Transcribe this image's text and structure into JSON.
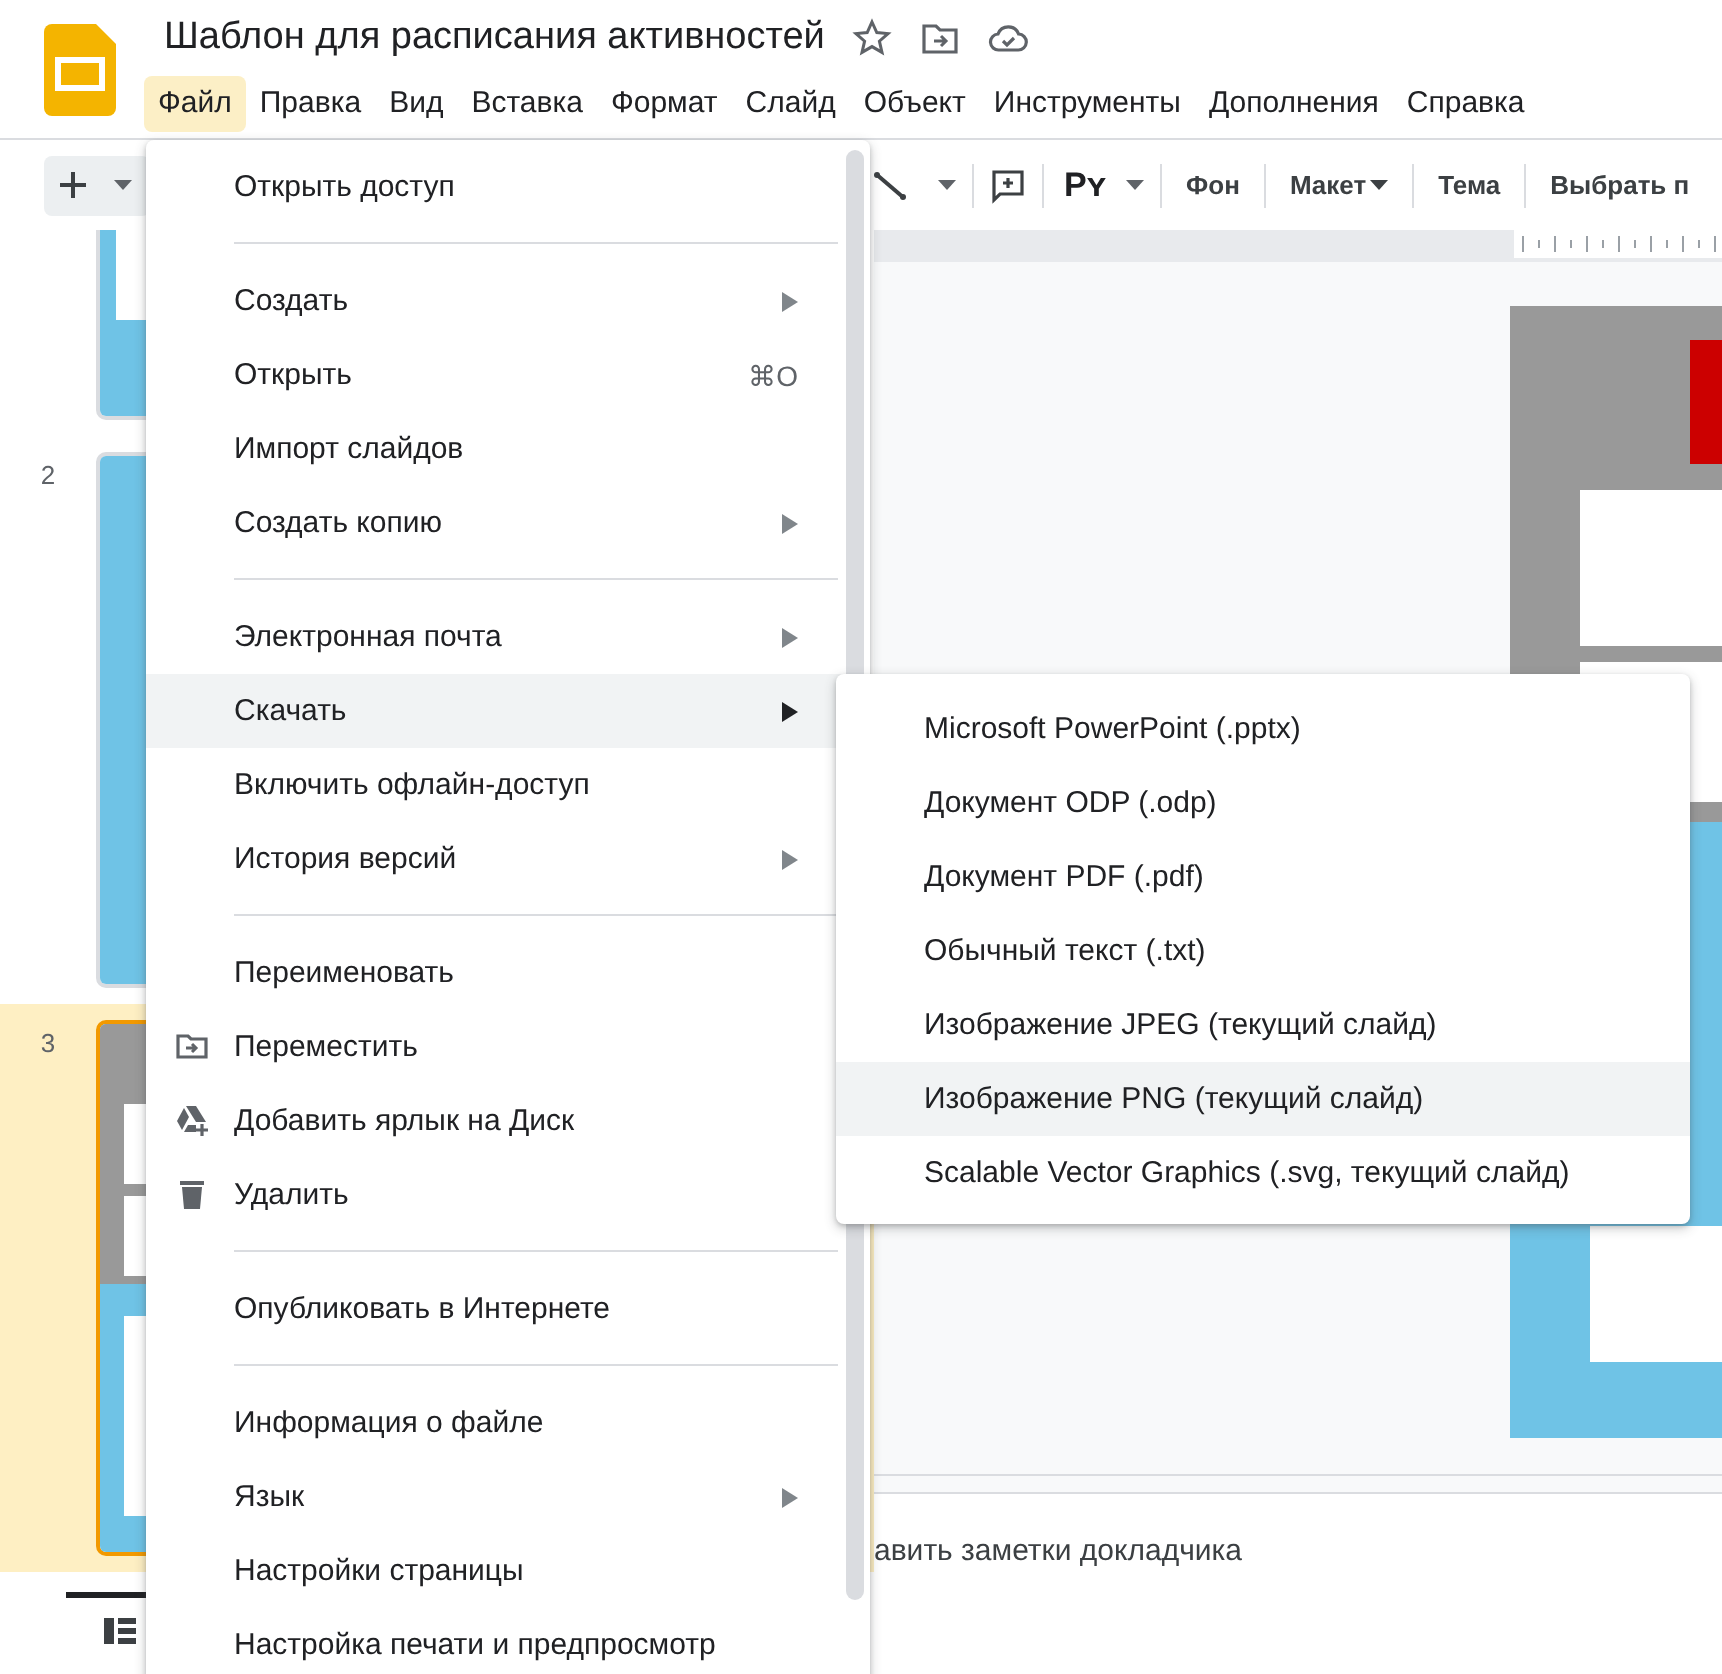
{
  "app": {
    "title": "Шаблон для расписания активностей"
  },
  "menubar": [
    {
      "label": "Файл",
      "selected": true
    },
    {
      "label": "Правка",
      "selected": false
    },
    {
      "label": "Вид",
      "selected": false
    },
    {
      "label": "Вставка",
      "selected": false
    },
    {
      "label": "Формат",
      "selected": false
    },
    {
      "label": "Слайд",
      "selected": false
    },
    {
      "label": "Объект",
      "selected": false
    },
    {
      "label": "Инструменты",
      "selected": false
    },
    {
      "label": "Дополнения",
      "selected": false
    },
    {
      "label": "Справка",
      "selected": false
    }
  ],
  "toolbar": {
    "format_label": "Pʏ",
    "items": [
      {
        "kind": "text",
        "label": "Фон"
      },
      {
        "kind": "dropdown",
        "label": "Макет"
      },
      {
        "kind": "text",
        "label": "Тема"
      },
      {
        "kind": "text",
        "label": "Выбрать п"
      }
    ]
  },
  "filmstrip": {
    "slides": [
      {
        "selected": false
      },
      {
        "number": "2",
        "selected": false
      },
      {
        "number": "3",
        "selected": true
      }
    ]
  },
  "notes": {
    "text": "авить заметки докладчика"
  },
  "file_menu": [
    {
      "kind": "item",
      "label": "Открыть доступ",
      "has_submenu": false,
      "selected": false
    },
    {
      "kind": "separator"
    },
    {
      "kind": "item",
      "label": "Создать",
      "has_submenu": true,
      "selected": false
    },
    {
      "kind": "item",
      "label": "Открыть",
      "shortcut": "⌘O",
      "has_submenu": false,
      "selected": false
    },
    {
      "kind": "item",
      "label": "Импорт слайдов",
      "has_submenu": false,
      "selected": false
    },
    {
      "kind": "item",
      "label": "Создать копию",
      "has_submenu": true,
      "selected": false
    },
    {
      "kind": "separator"
    },
    {
      "kind": "item",
      "label": "Электронная почта",
      "has_submenu": true,
      "selected": false
    },
    {
      "kind": "item",
      "label": "Скачать",
      "has_submenu": true,
      "selected": true
    },
    {
      "kind": "item",
      "label": "Включить офлайн-доступ",
      "has_submenu": false,
      "selected": false
    },
    {
      "kind": "item",
      "label": "История версий",
      "has_submenu": true,
      "selected": false
    },
    {
      "kind": "separator"
    },
    {
      "kind": "item",
      "label": "Переименовать",
      "has_submenu": false,
      "selected": false
    },
    {
      "kind": "move",
      "label": "Переместить",
      "has_submenu": false,
      "selected": false
    },
    {
      "kind": "shortcut",
      "label": "Добавить ярлык на Диск",
      "has_submenu": false,
      "selected": false
    },
    {
      "kind": "delete",
      "label": "Удалить",
      "has_submenu": false,
      "selected": false
    },
    {
      "kind": "separator"
    },
    {
      "kind": "item",
      "label": "Опубликовать в Интернете",
      "has_submenu": false,
      "selected": false
    },
    {
      "kind": "separator"
    },
    {
      "kind": "item",
      "label": "Информация о файле",
      "has_submenu": false,
      "selected": false
    },
    {
      "kind": "item",
      "label": "Язык",
      "has_submenu": true,
      "selected": false
    },
    {
      "kind": "item",
      "label": "Настройки страницы",
      "has_submenu": false,
      "selected": false
    },
    {
      "kind": "item",
      "label": "Настройка печати и предпросмотр",
      "has_submenu": false,
      "selected": false
    }
  ],
  "download_menu": [
    {
      "label": "Microsoft PowerPoint (.pptx)",
      "selected": false
    },
    {
      "label": "Документ ODP (.odp)",
      "selected": false
    },
    {
      "label": "Документ PDF (.pdf)",
      "selected": false
    },
    {
      "label": "Обычный текст (.txt)",
      "selected": false
    },
    {
      "label": "Изображение JPEG (текущий слайд)",
      "selected": false
    },
    {
      "label": "Изображение PNG (текущий слайд)",
      "selected": true
    },
    {
      "label": "Scalable Vector Graphics (.svg, текущий слайд)",
      "selected": false
    }
  ]
}
